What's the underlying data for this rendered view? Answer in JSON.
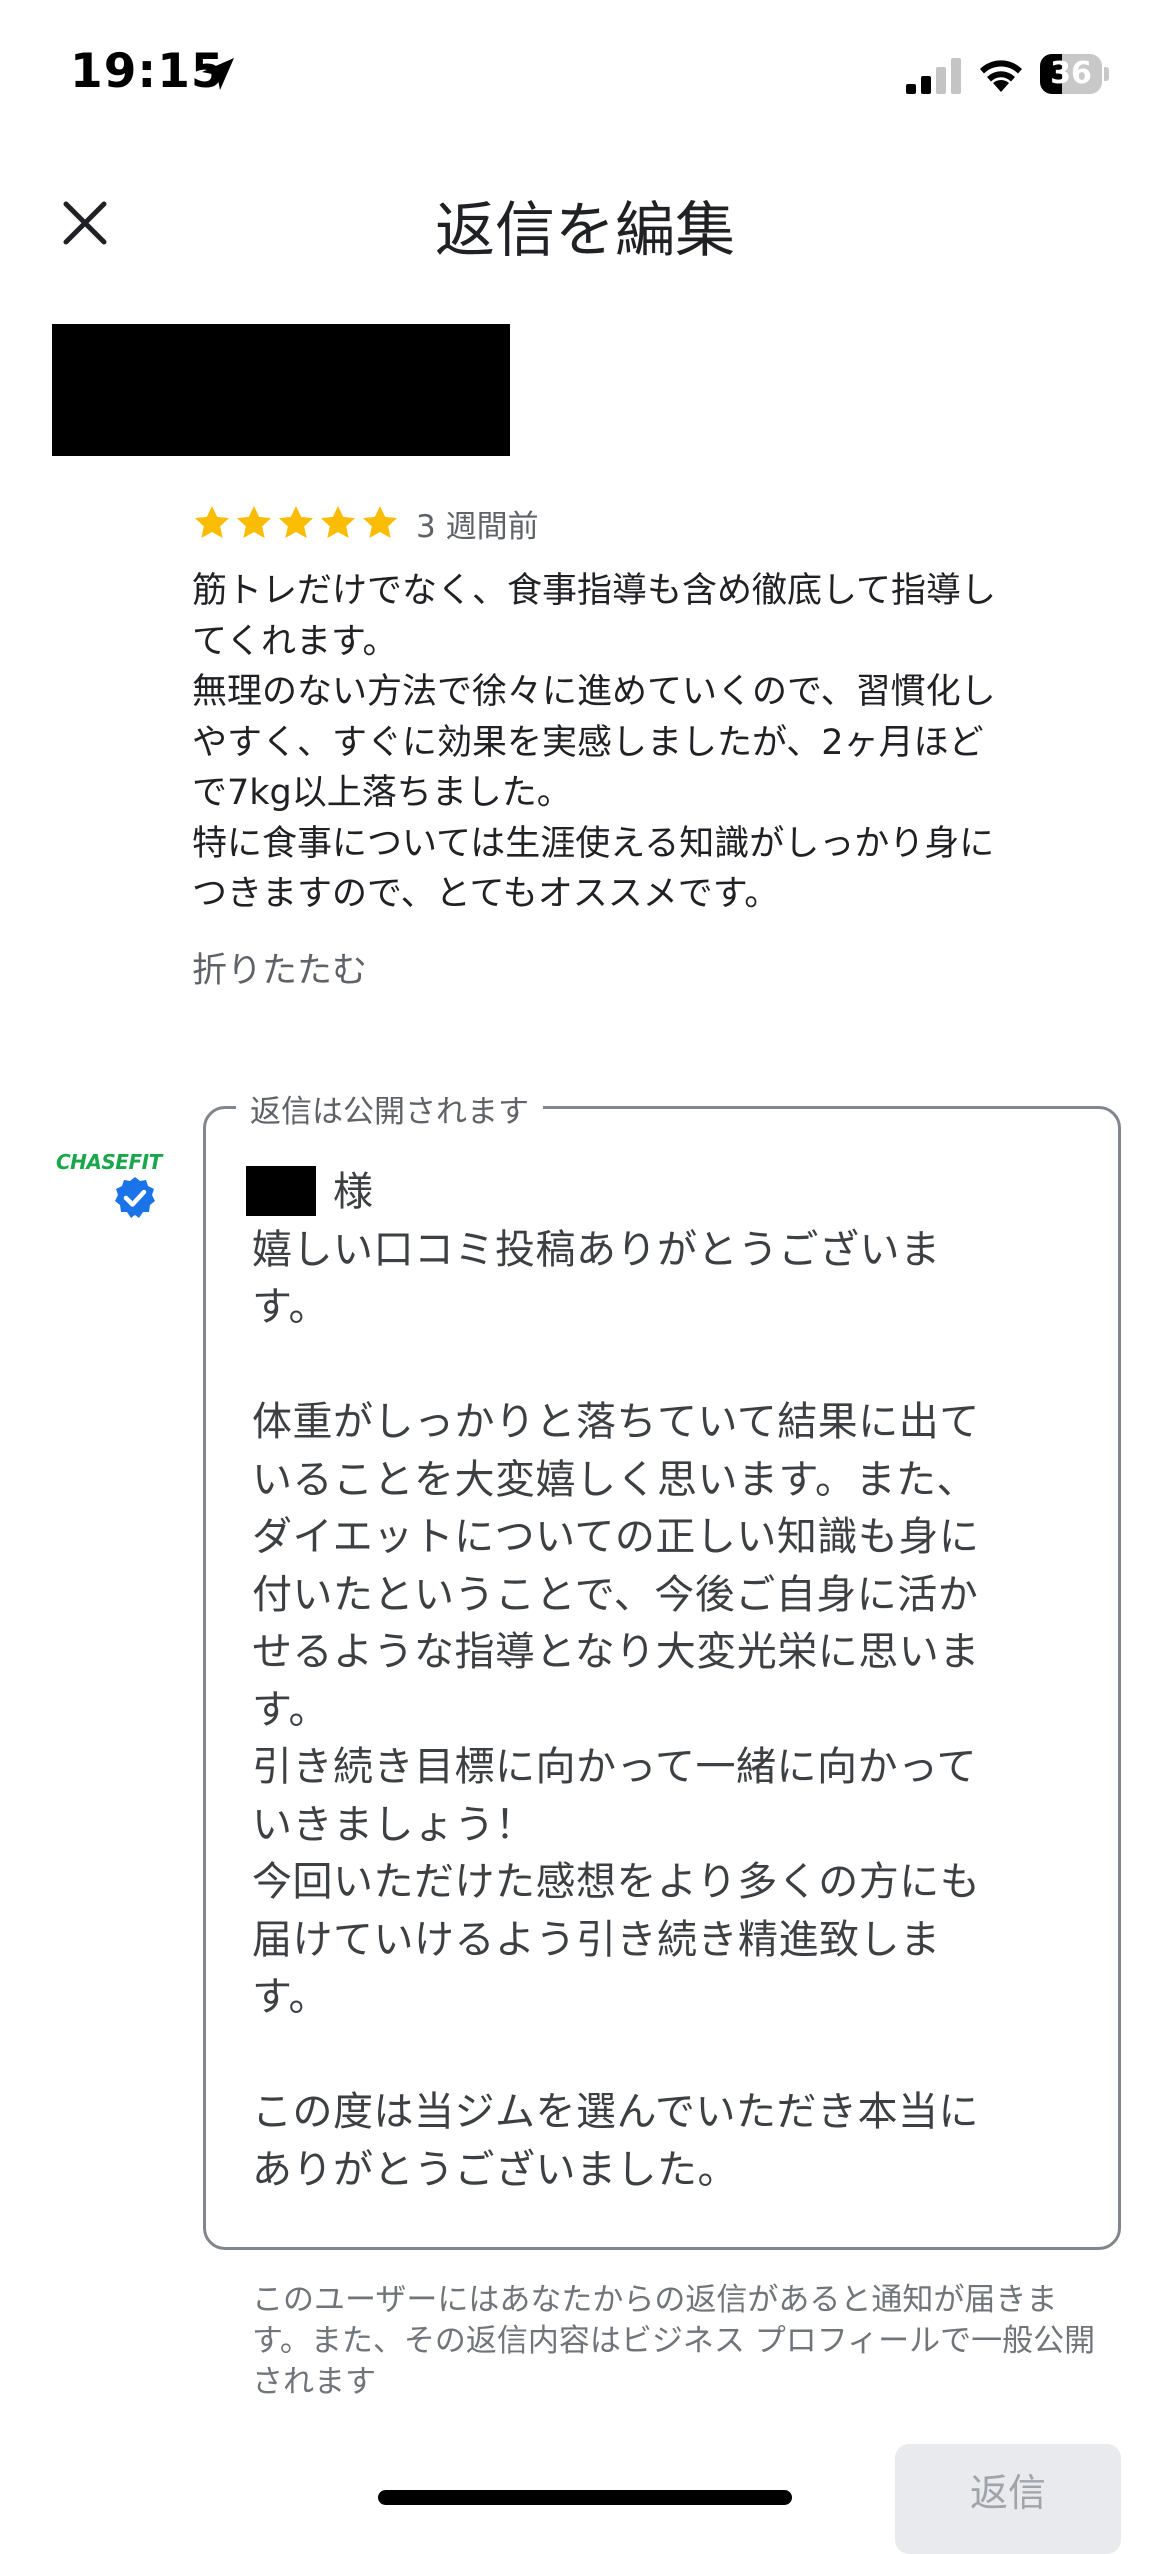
{
  "status_bar": {
    "time": "19:15",
    "battery_level": "36",
    "battery_fraction": 0.36,
    "icons": [
      "location-arrow-icon",
      "cellular-signal-icon",
      "wifi-icon",
      "battery-icon"
    ]
  },
  "header": {
    "title": "返信を編集",
    "close_icon": "close-icon"
  },
  "review": {
    "rating": 5,
    "star_color": "#fbbc04",
    "time_ago": "3 週間前",
    "text": "筋トレだけでなく、食事指導も含め徹底して指導し\nてくれます。\n無理のない方法で徐々に進めていくので、習慣化し\nやすく、すぐに効果を実感しましたが、2ヶ月ほど\nで7kg以上落ちました。\n特に食事については生涯使える知識がしっかり身に\nつきますので、とてもオススメです。",
    "collapse_label": "折りたたむ"
  },
  "business": {
    "logo_text": "CHASEFIT",
    "logo_color": "#1aa64b",
    "verified_icon": "verified-check-icon",
    "verified_color": "#1a73e8"
  },
  "reply": {
    "field_label": "返信は公開されます",
    "text": "　　様\n嬉しい口コミ投稿ありがとうございま\nす。\n\n体重がしっかりと落ちていて結果に出て\nいることを大変嬉しく思います。また、\nダイエットについての正しい知識も身に\n付いたということで、今後ご自身に活か\nせるような指導となり大変光栄に思いま\nす。\n引き続き目標に向かって一緒に向かって\nいきましょう！\n今回いただけた感想をより多くの方にも\n届けていけるよう引き続き精進致しま\nす。\n\nこの度は当ジムを選んでいただき本当に\nありがとうございました。"
  },
  "footer": {
    "notice": "このユーザーにはあなたからの返信があると通知が届きます。また、その返信内容はビジネス プロフィールで一般公開されます",
    "reply_button_label": "返信"
  }
}
